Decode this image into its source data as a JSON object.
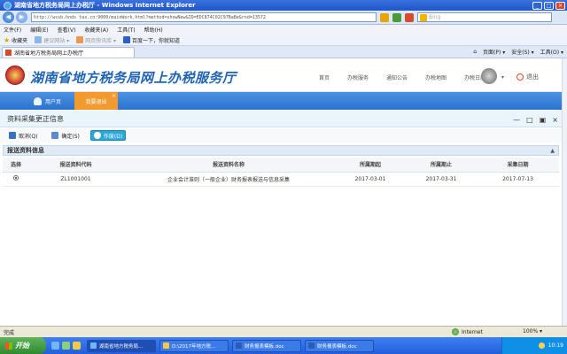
{
  "window": {
    "title": "湖南省地方税务局网上办税厅 - Windows Internet Explorer",
    "minimize": "_",
    "maximize": "□",
    "close": "×"
  },
  "addressbar": {
    "back": "◀",
    "forward": "▶",
    "url": "http://wssb.hnds tax.cn:9000/mainWork.html?method=showNew&ID=EDC874C02C97BaBe&rnd=13572",
    "search_placeholder": "Bing"
  },
  "menubar": {
    "items": [
      "文件(F)",
      "编辑(E)",
      "查看(V)",
      "收藏夹(A)",
      "工具(T)",
      "帮助(H)"
    ]
  },
  "favorites": {
    "label": "收藏夹",
    "items": [
      "建议网站 ▾",
      "网页快讯库 ▾",
      "百度一下，你就知道"
    ]
  },
  "tab": {
    "label": "湖南省地方税务局网上办税厅"
  },
  "tabtools": {
    "items": [
      "页面(P) ▾",
      "安全(S) ▾",
      "工具(O) ▾"
    ]
  },
  "header": {
    "site_title": "湖南省地方税务局网上办税服务厅",
    "nav": [
      "首页",
      "办税服务",
      "通知公告",
      "办税地图",
      "办税日历"
    ],
    "caret": "▾",
    "logout": "退出"
  },
  "navband": {
    "user_page": "用户页",
    "task_tab": "我要退出",
    "task_close": "×"
  },
  "panel": {
    "title": "资料采集更正信息",
    "controls": [
      "—",
      "□",
      "▣",
      "×"
    ]
  },
  "toolbar": {
    "buttons": [
      "取消(Q)",
      "确定(S)",
      "作废(D)"
    ]
  },
  "section": {
    "title": "报送资料信息",
    "collapse": "▲"
  },
  "table": {
    "columns": [
      "选择",
      "报送资料代码",
      "报送资料名称",
      "所属期起",
      "所属期止",
      "采集日期"
    ],
    "rows": [
      [
        "",
        "ZL1001001",
        "企业会计准则（一般企业）财务报表报送与信息采集",
        "2017-03-01",
        "2017-03-31",
        "2017-07-13"
      ]
    ]
  },
  "statusbar": {
    "left": "完成",
    "zone": "Internet",
    "zoom": "100% ▾"
  },
  "taskbar": {
    "start": "开始",
    "windows": [
      "湖南省地方税务局...",
      "D:\\2017年地方税...",
      "财务报表模板.doc",
      "财务报表模板.doc"
    ],
    "clock": "10:19"
  },
  "colors": {
    "accent_blue": "#2a72cf",
    "active_tab_orange": "#f39a2e",
    "selected_button": "#2aa8d8"
  }
}
